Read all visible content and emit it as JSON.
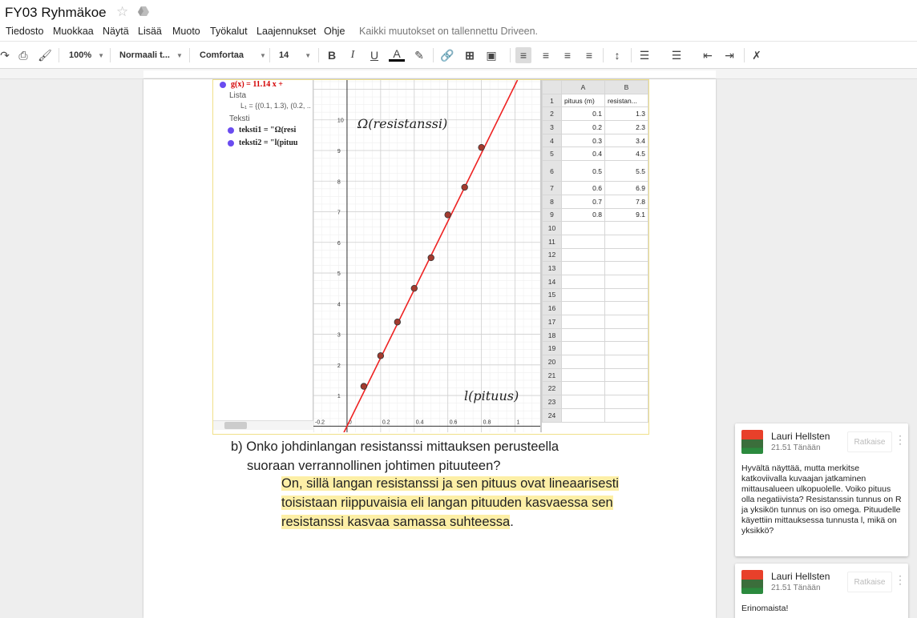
{
  "title": "FY03 Ryhmäkoe",
  "menu": [
    "Tiedosto",
    "Muokkaa",
    "Näytä",
    "Lisää",
    "Muoto",
    "Työkalut",
    "Laajennukset",
    "Ohje"
  ],
  "save_status": "Kaikki muutokset on tallennettu Driveen.",
  "toolbar": {
    "zoom": "100%",
    "style": "Normaali t...",
    "font": "Comfortaa",
    "size": "14"
  },
  "icons": {
    "star": "star-icon",
    "drive": "drive-icon",
    "bold": "B",
    "italic": "I",
    "underline": "U",
    "text_color": "A"
  },
  "geogebra": {
    "algebra": {
      "function_label": "g(x) = 11.14 x +",
      "list_heading": "Lista",
      "list_value": "L₁ = {(0.1, 1.3), (0.2, ..",
      "text_heading": "Teksti",
      "text1": "teksti1 = \"Ω(resi",
      "text2": "teksti2 = \"l(pituu"
    },
    "graph_labels": {
      "y_label": "Ω(resistanssi)",
      "x_label": "l(pituus)"
    },
    "spreadsheet": {
      "columns": [
        "A",
        "B"
      ],
      "header_row": [
        "pituus (m)",
        "resistan..."
      ],
      "rows": [
        [
          "0.1",
          "1.3"
        ],
        [
          "0.2",
          "2.3"
        ],
        [
          "0.3",
          "3.4"
        ],
        [
          "0.4",
          "4.5"
        ],
        [
          "0.5",
          "5.5"
        ],
        [
          "0.6",
          "6.9"
        ],
        [
          "0.7",
          "7.8"
        ],
        [
          "0.8",
          "9.1"
        ]
      ],
      "row_numbers": [
        "1",
        "2",
        "3",
        "4",
        "5",
        "6",
        "7",
        "8",
        "9",
        "10",
        "11",
        "12",
        "13",
        "14",
        "15",
        "16",
        "17",
        "18",
        "19",
        "20",
        "21",
        "22",
        "23",
        "24"
      ]
    },
    "chart_data": {
      "type": "scatter",
      "x": [
        0.1,
        0.2,
        0.3,
        0.4,
        0.5,
        0.6,
        0.7,
        0.8
      ],
      "y": [
        1.3,
        2.3,
        3.4,
        4.5,
        5.5,
        6.9,
        7.8,
        9.1
      ],
      "fit_line": {
        "slope": 11.14,
        "intercept": 0.0
      },
      "xlim": [
        -0.2,
        1.15
      ],
      "ylim": [
        -0.2,
        11.3
      ],
      "x_ticks": [
        "-0.2",
        "0",
        "0.2",
        "0.4",
        "0.6",
        "0.8",
        "1"
      ],
      "y_ticks": [
        "1",
        "2",
        "3",
        "4",
        "5",
        "6",
        "7",
        "8",
        "9",
        "10"
      ],
      "point_color": "#a33b2f",
      "line_color": "#ee2222",
      "grid": true
    }
  },
  "document": {
    "question": "b) Onko johdinlangan resistanssi mittauksen perusteella",
    "question_line2": "suoraan verrannollinen johtimen pituuteen?",
    "answer_highlighted": "On, sillä langan resistanssi ja sen pituus ovat lineaarisesti toisistaan riippuvaisia eli langan pituuden kasvaessa sen resistanssi kasvaa samassa suhteessa",
    "answer_end": "."
  },
  "comments": [
    {
      "author": "Lauri Hellsten",
      "time": "21.51 Tänään",
      "resolve": "Ratkaise",
      "text": "Hyvältä näyttää, mutta merkitse katkoviivalla kuvaajan jatkaminen mittausalueen ulkopuolelle. Voiko pituus olla negatiivista? Resistanssin tunnus on R ja yksikön tunnus on iso omega. Pituudelle käyettiin mittauksessa tunnusta l, mikä on yksikkö?"
    },
    {
      "author": "Lauri Hellsten",
      "time": "21.51 Tänään",
      "resolve": "Ratkaise",
      "text": "Erinomaista!"
    }
  ]
}
